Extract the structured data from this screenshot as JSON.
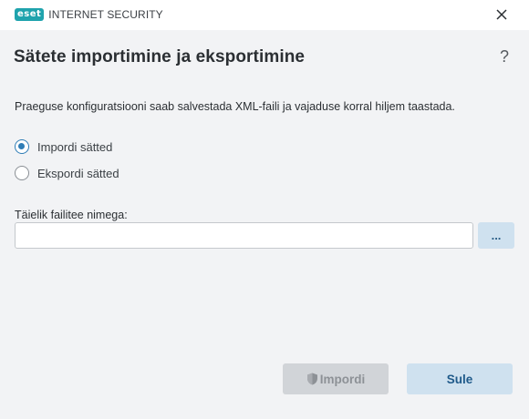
{
  "window": {
    "brand_badge": "eset",
    "product_name": "INTERNET SECURITY",
    "close_icon": "close-icon"
  },
  "header": {
    "title": "Sätete importimine ja eksportimine",
    "help_label": "?"
  },
  "main": {
    "description": "Praeguse konfiguratsiooni saab salvestada XML-faili ja vajaduse korral hiljem taastada.",
    "options": [
      {
        "label": "Impordi sätted",
        "selected": true
      },
      {
        "label": "Ekspordi sätted",
        "selected": false
      }
    ],
    "path_field": {
      "label": "Täielik failitee nimega:",
      "value": "",
      "browse_label": "..."
    }
  },
  "footer": {
    "import_label": "Impordi",
    "import_icon": "shield-icon",
    "import_enabled": false,
    "close_label": "Sule"
  },
  "colors": {
    "brand": "#1fa3ad",
    "accent": "#2f7db6",
    "secondary_button": "#cfe1ef",
    "disabled_button": "#d1d4d8",
    "background": "#f2f3f5"
  }
}
